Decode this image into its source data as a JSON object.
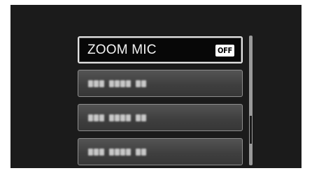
{
  "menu": {
    "items": [
      {
        "label": "ZOOM MIC",
        "value": "OFF",
        "selected": true
      },
      {
        "label": "",
        "blurred": true
      },
      {
        "label": "",
        "blurred": true
      },
      {
        "label": "",
        "blurred": true
      }
    ]
  },
  "scrollbar": {
    "position": "lower-middle"
  },
  "colors": {
    "screen_bg": "#1b1b1b",
    "item_bg": "#444444",
    "selected_bg": "#070707",
    "text": "#f2f2f2"
  }
}
